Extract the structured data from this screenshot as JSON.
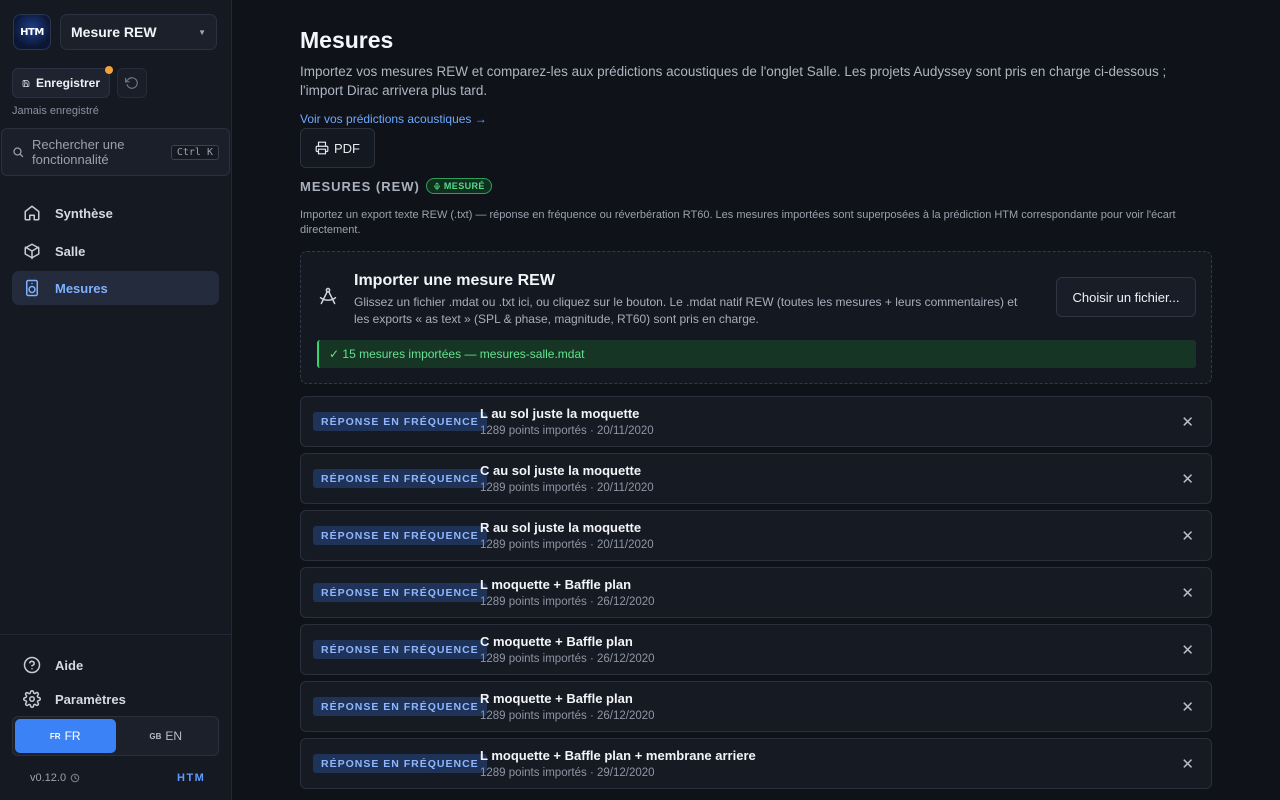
{
  "app": {
    "logo_text": "HTM",
    "project_name": "Mesure REW",
    "save_label": "Enregistrer",
    "save_status": "Jamais enregistré",
    "search_placeholder": "Rechercher une fonctionnalité",
    "search_shortcut": "Ctrl K",
    "brand": "HTM",
    "version": "v0.12.0"
  },
  "nav": {
    "items": [
      {
        "label": "Synthèse",
        "icon": "home-icon"
      },
      {
        "label": "Salle",
        "icon": "cube-icon"
      },
      {
        "label": "Mesures",
        "icon": "speaker-icon"
      }
    ],
    "active": "Mesures",
    "footer": [
      {
        "label": "Aide",
        "icon": "help-circle-icon"
      },
      {
        "label": "Paramètres",
        "icon": "gear-icon"
      }
    ]
  },
  "languages": [
    {
      "flag": "FR",
      "label": "FR"
    },
    {
      "flag": "GB",
      "label": "EN"
    }
  ],
  "main": {
    "title": "Mesures",
    "intro": "Importez vos mesures REW et comparez-les aux prédictions acoustiques de l'onglet Salle. Les projets Audyssey sont pris en charge ci-dessous ; l'import Dirac arrivera plus tard.",
    "link_label": "Voir vos prédictions acoustiques →",
    "pdf_label": "PDF",
    "section_title": "MESURES (REW)",
    "section_badge": "MESURÉ",
    "section_desc": "Importez un export texte REW (.txt) — réponse en fréquence ou réverbération RT60. Les mesures importées sont superposées à la prédiction HTM correspondante pour voir l'écart directement.",
    "import": {
      "title": "Importer une mesure REW",
      "desc": "Glissez un fichier .mdat ou .txt ici, ou cliquez sur le bouton. Le .mdat natif REW (toutes les mesures + leurs commentaires) et les exports « as text » (SPL & phase, magnitude, RT60) sont pris en charge.",
      "button": "Choisir un fichier...",
      "success": "✓ 15 mesures importées — mesures-salle.mdat"
    }
  },
  "measurements": [
    {
      "type": "RÉPONSE EN FRÉQUENCE",
      "name": "L au sol juste la moquette",
      "meta": "1289 points importés · 20/11/2020"
    },
    {
      "type": "RÉPONSE EN FRÉQUENCE",
      "name": "C au sol juste la moquette",
      "meta": "1289 points importés · 20/11/2020"
    },
    {
      "type": "RÉPONSE EN FRÉQUENCE",
      "name": "R au sol juste la moquette",
      "meta": "1289 points importés · 20/11/2020"
    },
    {
      "type": "RÉPONSE EN FRÉQUENCE",
      "name": "L moquette + Baffle plan",
      "meta": "1289 points importés · 26/12/2020"
    },
    {
      "type": "RÉPONSE EN FRÉQUENCE",
      "name": "C moquette + Baffle plan",
      "meta": "1289 points importés · 26/12/2020"
    },
    {
      "type": "RÉPONSE EN FRÉQUENCE",
      "name": "R moquette + Baffle plan",
      "meta": "1289 points importés · 26/12/2020"
    },
    {
      "type": "RÉPONSE EN FRÉQUENCE",
      "name": "L moquette + Baffle plan + membrane arriere",
      "meta": "1289 points importés · 29/12/2020"
    }
  ],
  "colors": {
    "accent": "#3b82f6",
    "link": "#6ea8ff",
    "success": "#63e28f",
    "unsaved_dot": "#f2a23a"
  }
}
